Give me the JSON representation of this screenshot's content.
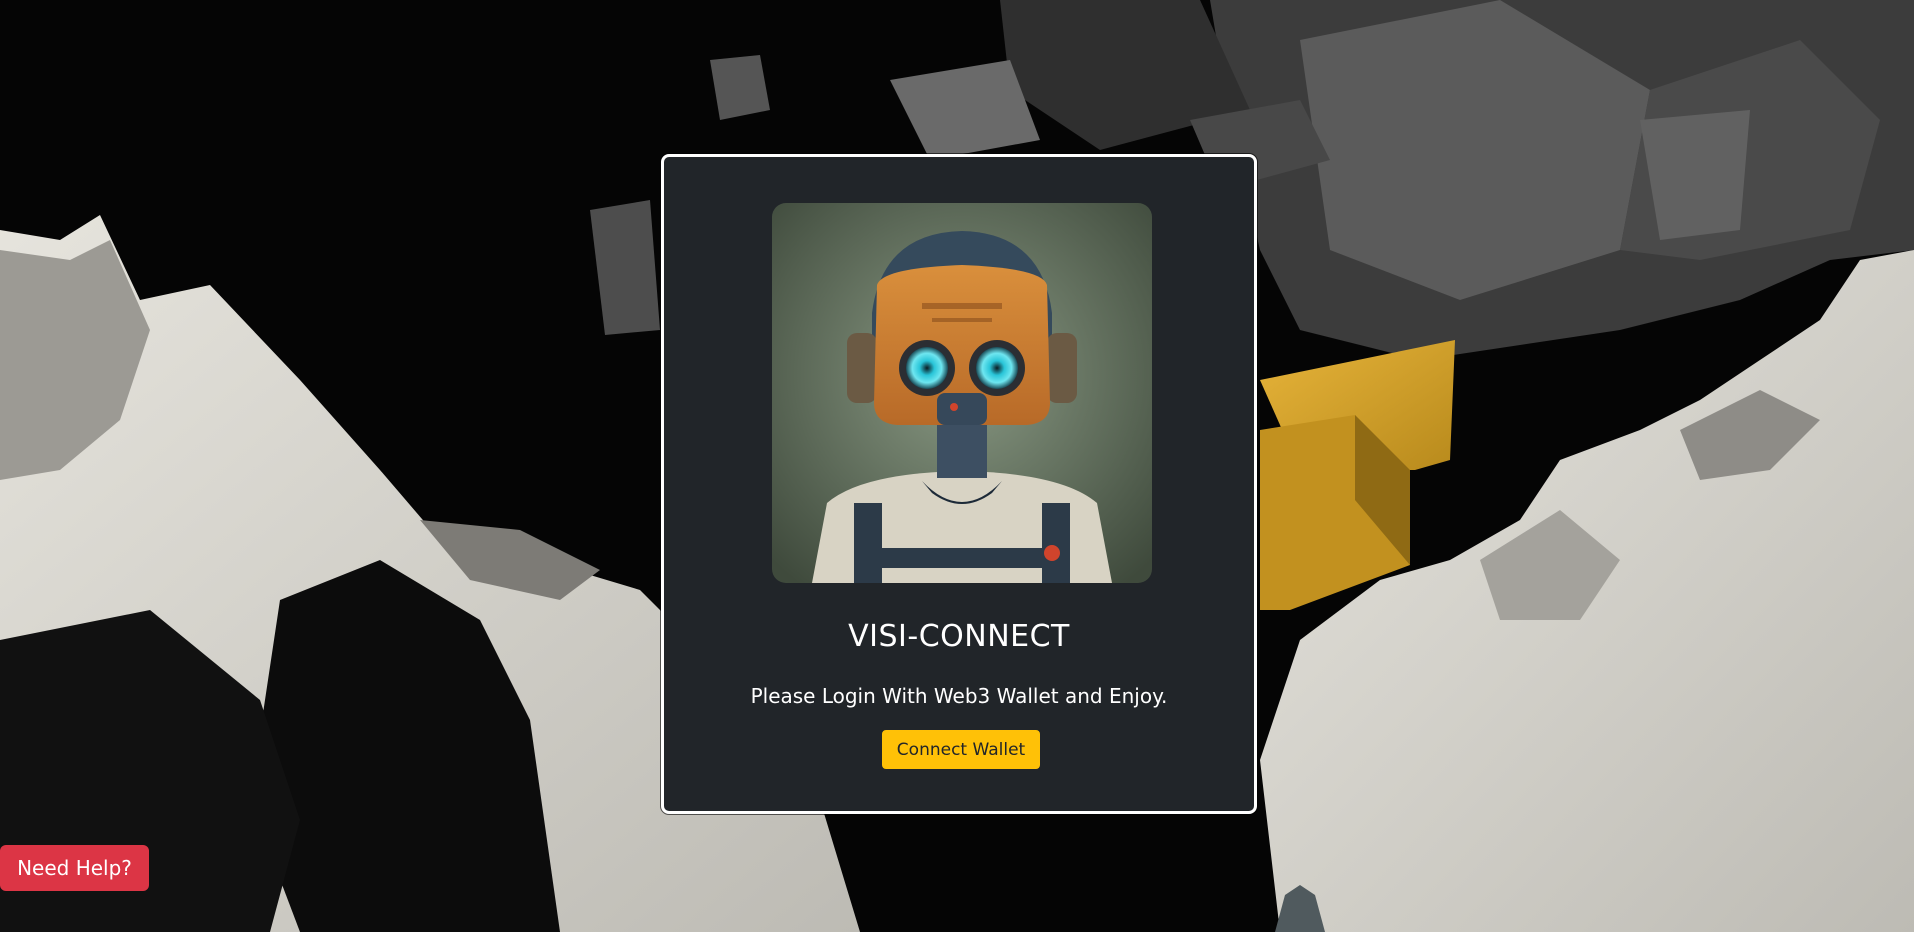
{
  "modal": {
    "title": "VISI-CONNECT",
    "subtitle": "Please Login With Web3 Wallet and Enjoy.",
    "connect_button_label": "Connect Wallet"
  },
  "help_button_label": "Need Help?",
  "colors": {
    "modal_background": "#212529",
    "modal_border": "#ffffff",
    "connect_button": "#ffc107",
    "help_button": "#dc3545"
  }
}
